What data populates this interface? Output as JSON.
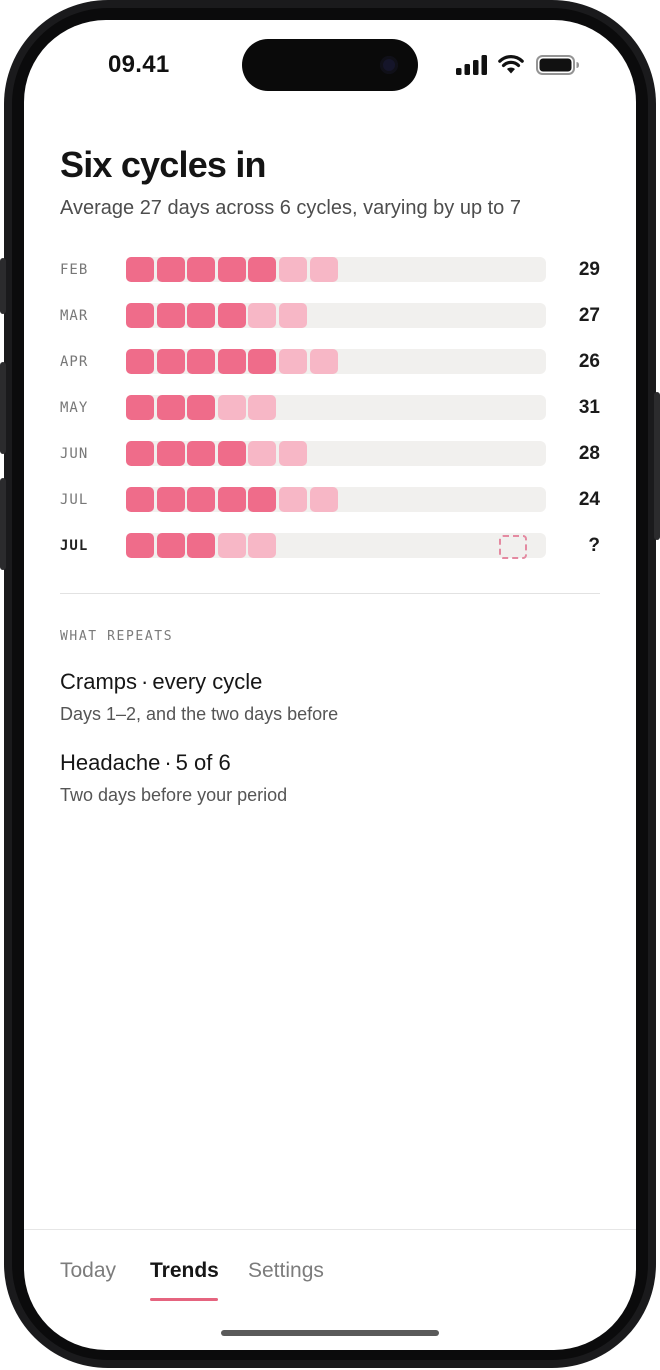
{
  "status_bar": {
    "time": "09.41",
    "icons": [
      "cellular-signal-icon",
      "wifi-icon",
      "battery-icon"
    ]
  },
  "header": {
    "title": "Six cycles in",
    "subtitle": "Average 27 days across 6 cycles, varying by up to 7"
  },
  "colors": {
    "period_full": "#ef6c8a",
    "period_light": "#f7b7c6",
    "track": "#f1f0ee",
    "accent": "#e5647f"
  },
  "cycles": [
    {
      "month": "FEB",
      "full_days": 5,
      "light_days": 2,
      "length": "29",
      "current": false
    },
    {
      "month": "MAR",
      "full_days": 4,
      "light_days": 2,
      "length": "27",
      "current": false
    },
    {
      "month": "APR",
      "full_days": 5,
      "light_days": 2,
      "length": "26",
      "current": false
    },
    {
      "month": "MAY",
      "full_days": 3,
      "light_days": 2,
      "length": "31",
      "current": false
    },
    {
      "month": "JUN",
      "full_days": 4,
      "light_days": 2,
      "length": "28",
      "current": false
    },
    {
      "month": "JUL",
      "full_days": 5,
      "light_days": 2,
      "length": "24",
      "current": false
    },
    {
      "month": "JUL",
      "full_days": 3,
      "light_days": 2,
      "length": "?",
      "current": true,
      "predicted_next": true
    }
  ],
  "repeats": {
    "label": "WHAT REPEATS",
    "items": [
      {
        "symptom": "Cramps",
        "frequency": "every cycle",
        "detail": "Days 1–2, and the two days before"
      },
      {
        "symptom": "Headache",
        "frequency": "5 of 6",
        "detail": "Two days before your period"
      }
    ],
    "separator": "·"
  },
  "tabs": [
    {
      "label": "Today",
      "active": false
    },
    {
      "label": "Trends",
      "active": true
    },
    {
      "label": "Settings",
      "active": false
    }
  ]
}
